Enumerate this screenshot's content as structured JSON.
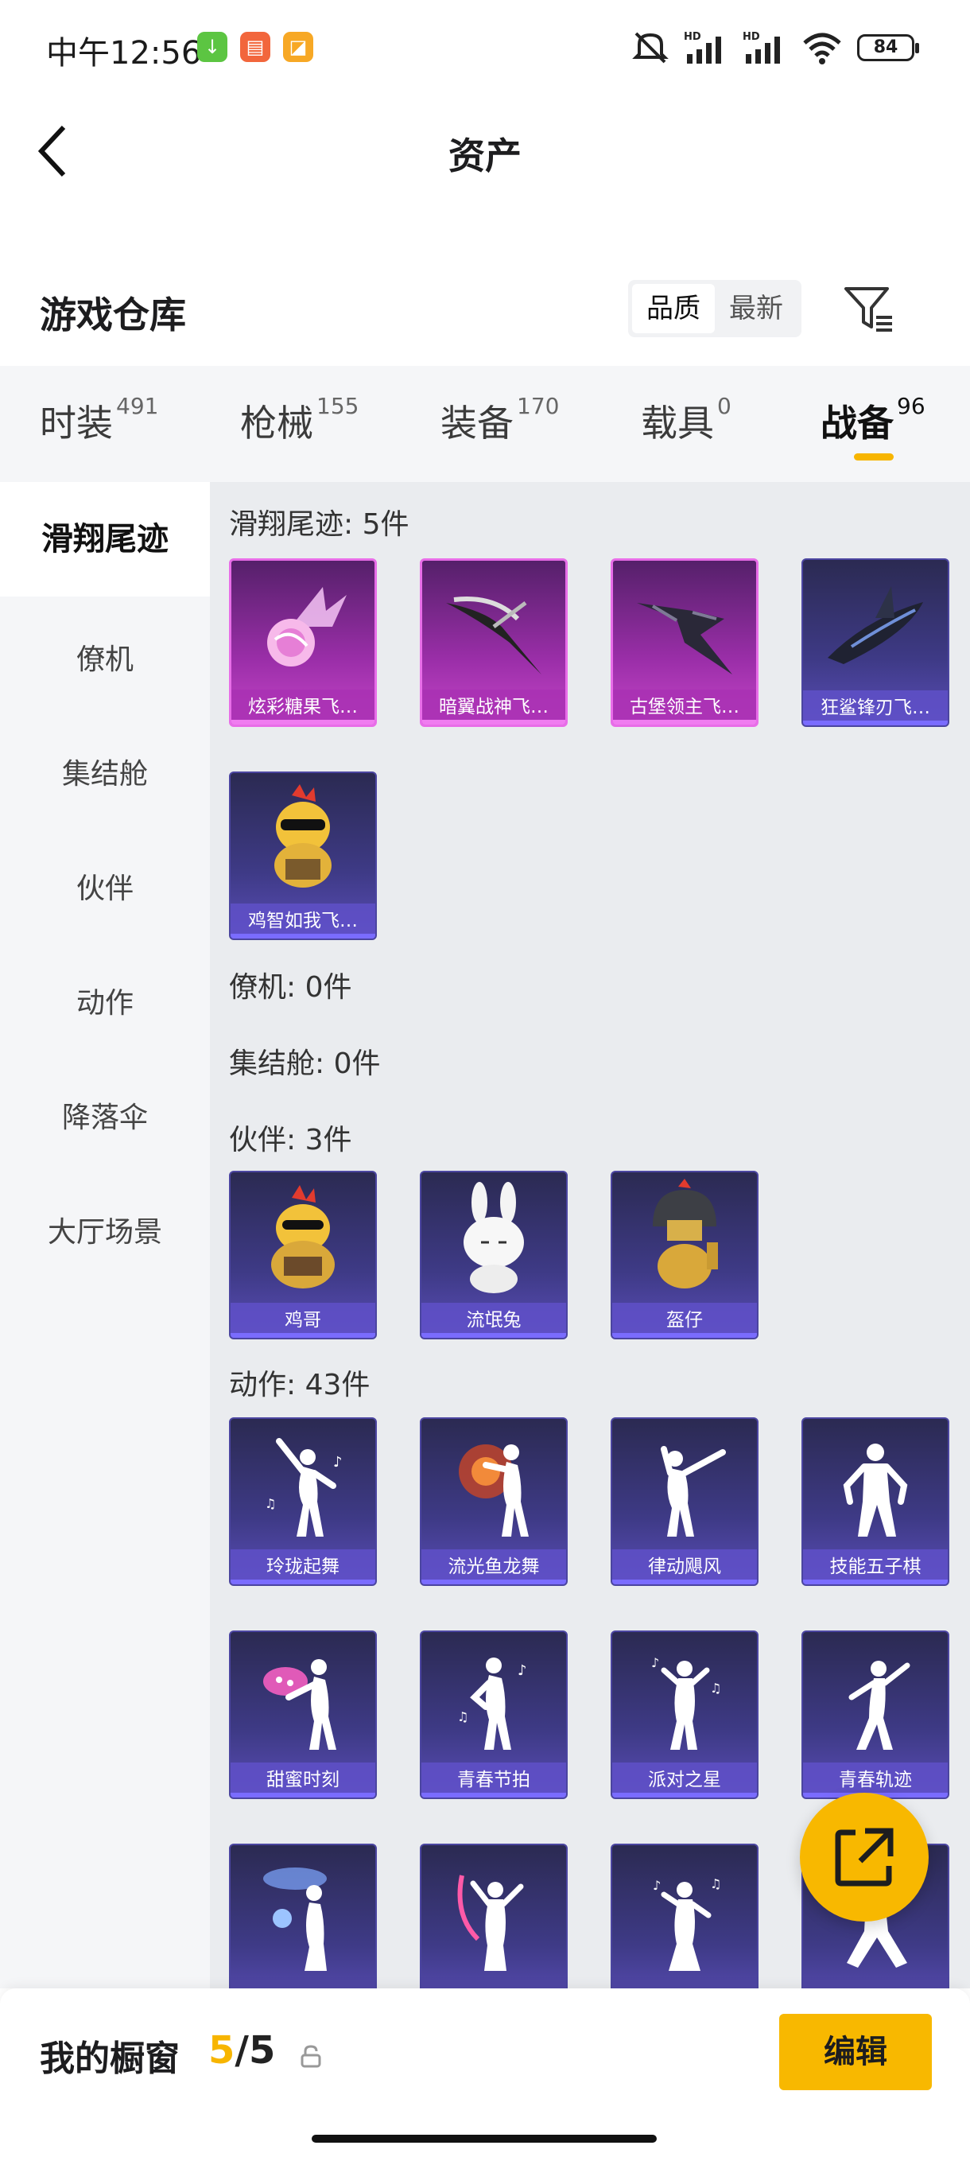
{
  "status_bar": {
    "time": "中午12:56",
    "battery": "84",
    "hd1": "HD",
    "hd2": "HD",
    "apps": [
      {
        "icon": "download-app-icon",
        "color": "#5cc542"
      },
      {
        "icon": "red-app-icon",
        "color": "#f2663c"
      },
      {
        "icon": "orange-app-icon",
        "color": "#f7a825"
      }
    ]
  },
  "header": {
    "title": "资产",
    "back_icon": "back-arrow-icon"
  },
  "warehouse": {
    "title": "游戏仓库",
    "sort_options": [
      "品质",
      "最新"
    ],
    "sort_selected": "品质",
    "filter_icon": "filter-icon"
  },
  "tabs": [
    {
      "label": "时装",
      "count": "491"
    },
    {
      "label": "枪械",
      "count": "155"
    },
    {
      "label": "装备",
      "count": "170"
    },
    {
      "label": "载具",
      "count": "0"
    },
    {
      "label": "战备",
      "count": "96",
      "active": true
    }
  ],
  "tab_accent_color": "#f7b500",
  "sidebar": {
    "items": [
      {
        "label": "滑翔尾迹",
        "active": true
      },
      {
        "label": "僚机"
      },
      {
        "label": "集结舱"
      },
      {
        "label": "伙伴"
      },
      {
        "label": "动作"
      },
      {
        "label": "降落伞"
      },
      {
        "label": "大厅场景"
      }
    ]
  },
  "sections": {
    "glide": {
      "title": "滑翔尾迹: 5件",
      "items": [
        "炫彩糖果飞…",
        "暗翼战神飞…",
        "古堡领主飞…",
        "狂鲨锋刃飞…",
        "鸡智如我飞…"
      ]
    },
    "wingman": {
      "title": "僚机: 0件"
    },
    "pod": {
      "title": "集结舱: 0件"
    },
    "partner": {
      "title": "伙伴: 3件",
      "items": [
        "鸡哥",
        "流氓兔",
        "盔仔"
      ]
    },
    "action": {
      "title": "动作: 43件",
      "items": [
        "玲珑起舞",
        "流光鱼龙舞",
        "律动飓风",
        "技能五子棋",
        "甜蜜时刻",
        "青春节拍",
        "派对之星",
        "青春轨迹"
      ]
    }
  },
  "fab": {
    "icon": "share-external-icon"
  },
  "bottom_bar": {
    "title": "我的橱窗",
    "count_current": "5",
    "count_total": "/5",
    "lock_icon": "lock-icon",
    "edit_label": "编辑"
  }
}
